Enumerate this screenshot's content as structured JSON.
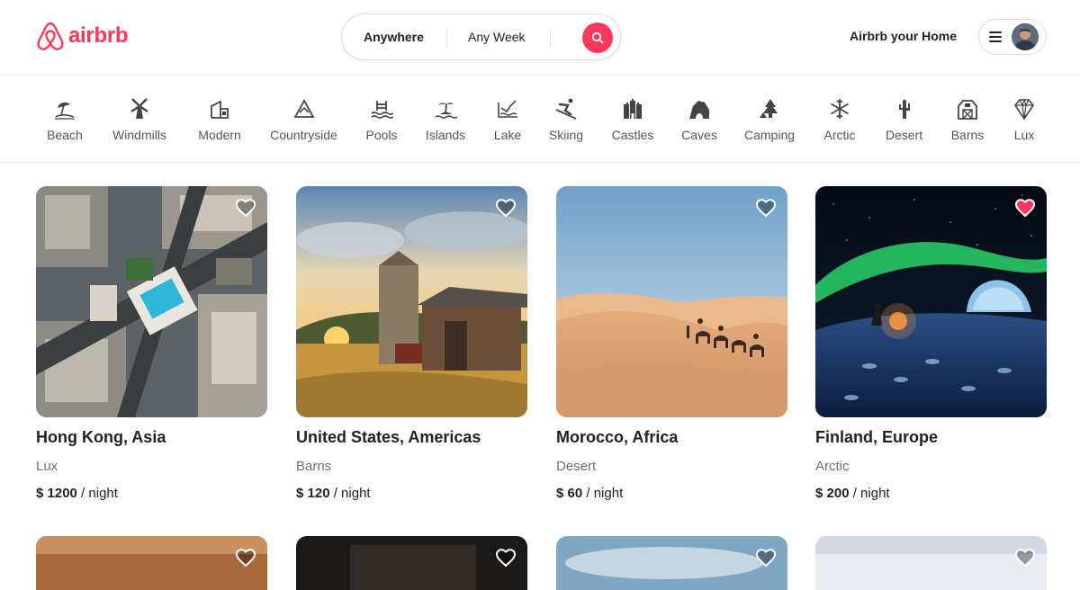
{
  "brand": {
    "name": "airbrb",
    "color": "#ff385c"
  },
  "search": {
    "where": "Anywhere",
    "when": "Any Week"
  },
  "header": {
    "host_link": "Airbrb your Home"
  },
  "categories": [
    {
      "label": "Beach",
      "icon": "beach-icon"
    },
    {
      "label": "Windmills",
      "icon": "windmill-icon"
    },
    {
      "label": "Modern",
      "icon": "modern-house-icon"
    },
    {
      "label": "Countryside",
      "icon": "countryside-icon"
    },
    {
      "label": "Pools",
      "icon": "pool-icon"
    },
    {
      "label": "Islands",
      "icon": "island-icon"
    },
    {
      "label": "Lake",
      "icon": "lake-icon"
    },
    {
      "label": "Skiing",
      "icon": "skiing-icon"
    },
    {
      "label": "Castles",
      "icon": "castle-icon"
    },
    {
      "label": "Caves",
      "icon": "cave-icon"
    },
    {
      "label": "Camping",
      "icon": "camping-icon"
    },
    {
      "label": "Arctic",
      "icon": "snowflake-icon"
    },
    {
      "label": "Desert",
      "icon": "cactus-icon"
    },
    {
      "label": "Barns",
      "icon": "barn-icon"
    },
    {
      "label": "Lux",
      "icon": "diamond-icon"
    }
  ],
  "listings": [
    {
      "title": "Hong Kong, Asia",
      "type": "Lux",
      "price": "$ 1200",
      "unit": " / night",
      "favorited": false
    },
    {
      "title": "United States, Americas",
      "type": "Barns",
      "price": "$ 120",
      "unit": " / night",
      "favorited": false
    },
    {
      "title": "Morocco, Africa",
      "type": "Desert",
      "price": "$ 60",
      "unit": " / night",
      "favorited": false
    },
    {
      "title": "Finland, Europe",
      "type": "Arctic",
      "price": "$ 200",
      "unit": " / night",
      "favorited": true
    }
  ],
  "colors": {
    "favorite": "#ff385c"
  }
}
